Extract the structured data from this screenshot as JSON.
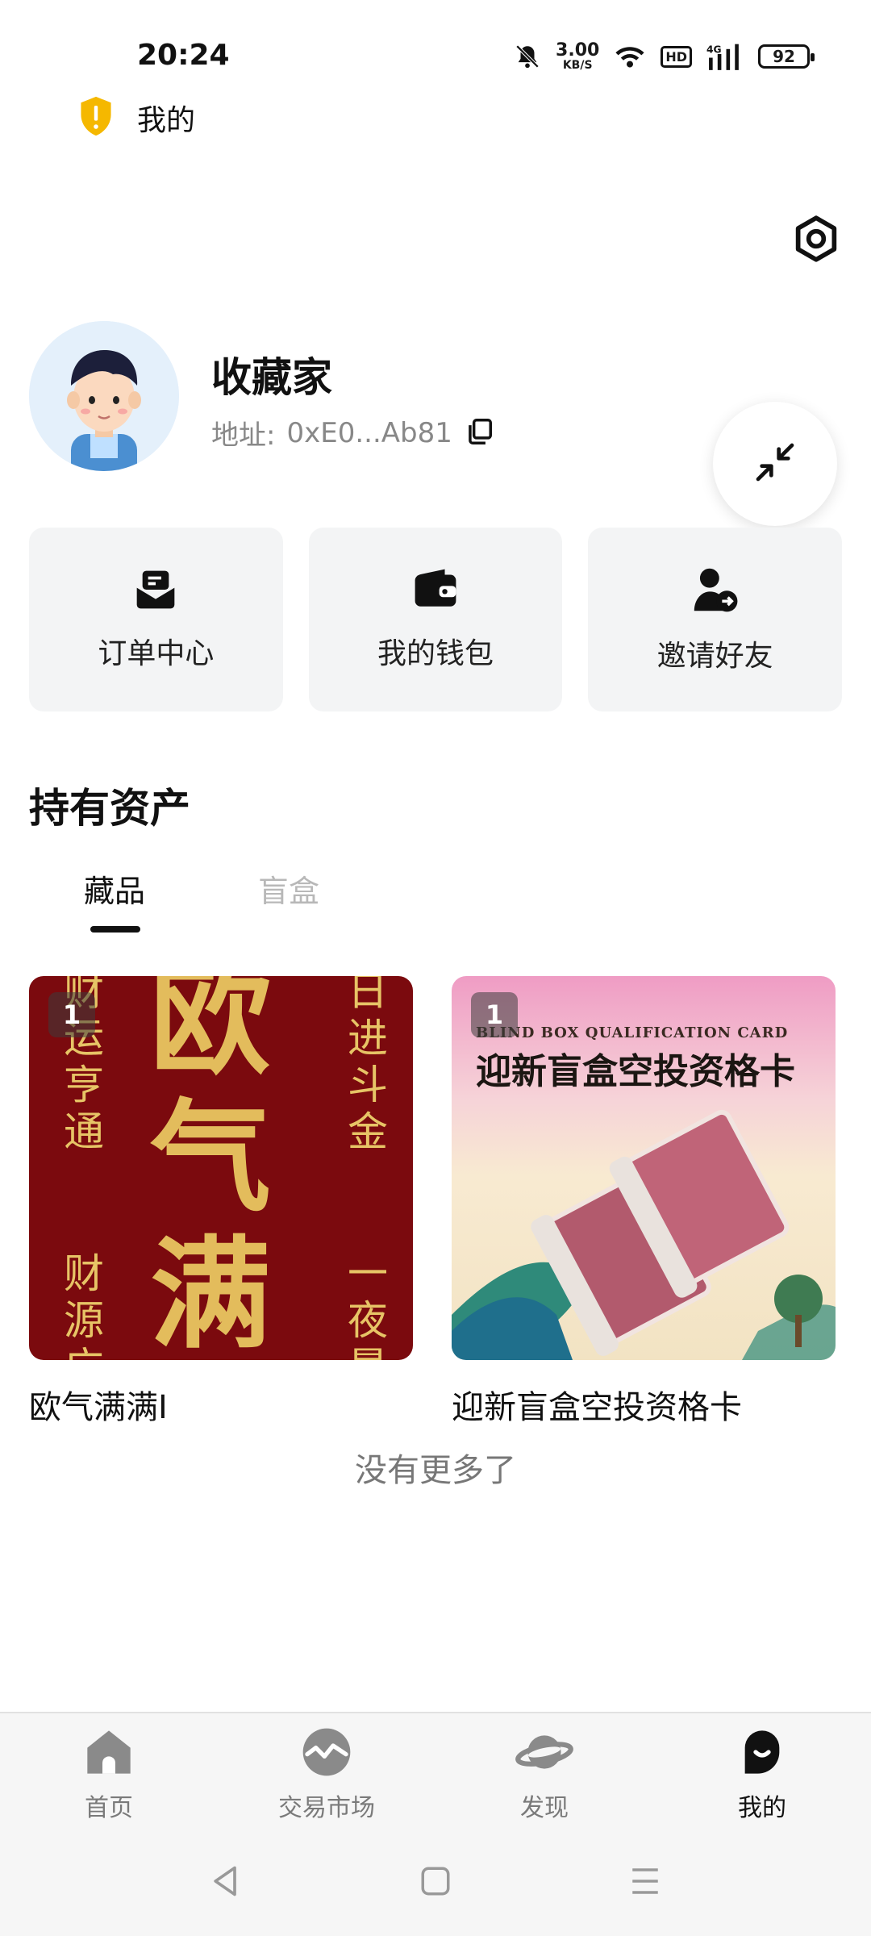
{
  "status_bar": {
    "time": "20:24",
    "net_speed_value": "3.00",
    "net_speed_unit": "KB/S",
    "hd": "HD",
    "network": "4G",
    "battery": "92"
  },
  "header": {
    "title": "我的"
  },
  "profile": {
    "name": "收藏家",
    "address_label": "地址:",
    "address_value": "0xE0...Ab81"
  },
  "quick_actions": [
    {
      "label": "订单中心",
      "icon": "order-icon"
    },
    {
      "label": "我的钱包",
      "icon": "wallet-icon"
    },
    {
      "label": "邀请好友",
      "icon": "invite-friend-icon"
    }
  ],
  "assets": {
    "title": "持有资产",
    "tabs": [
      {
        "label": "藏品",
        "active": true
      },
      {
        "label": "盲盒",
        "active": false
      }
    ],
    "items": [
      {
        "name": "欧气满满I",
        "count": "1",
        "art_text_main": "欧气满满",
        "art_text_left_top": "财运亨通",
        "art_text_right_top": "日进斗金",
        "art_text_left_bottom": "财源广",
        "art_text_right_bottom": "一夜暴"
      },
      {
        "name": "迎新盲盒空投资格卡",
        "count": "1",
        "art_text_en": "BLIND BOX QUALIFICATION CARD",
        "art_text_cn": "迎新盲盒空投资格卡"
      }
    ],
    "no_more": "没有更多了"
  },
  "bottom_nav": [
    {
      "label": "首页",
      "icon": "home-icon",
      "active": false
    },
    {
      "label": "交易市场",
      "icon": "market-icon",
      "active": false
    },
    {
      "label": "发现",
      "icon": "planet-icon",
      "active": false
    },
    {
      "label": "我的",
      "icon": "profile-icon",
      "active": true
    }
  ],
  "colors": {
    "accent": "#111111",
    "card_bg": "#f3f4f5",
    "muted_text": "#888888",
    "inactive_tab": "#b8b8b8",
    "shield": "#f5b800",
    "item1_bg": "#7b0a0e",
    "item1_gold": "#e3bc5c"
  }
}
